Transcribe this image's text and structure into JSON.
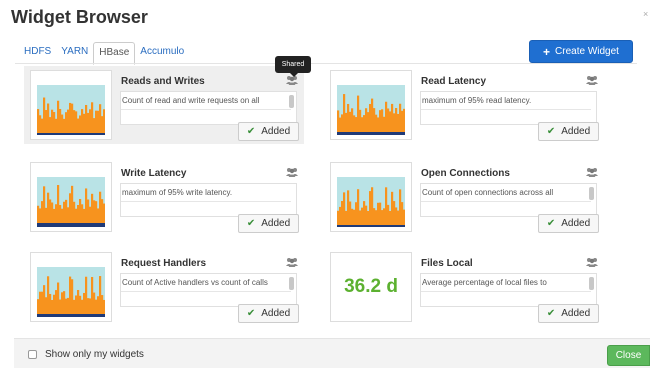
{
  "dialog": {
    "title": "Widget Browser"
  },
  "tabs": [
    {
      "label": "HDFS",
      "active": false
    },
    {
      "label": "YARN",
      "active": false
    },
    {
      "label": "HBase",
      "active": true
    },
    {
      "label": "Accumulo",
      "active": false
    }
  ],
  "create_button": {
    "label": "Create Widget",
    "icon": "plus-icon"
  },
  "tooltip": {
    "text": "Shared"
  },
  "widgets": [
    {
      "name": "Reads and Writes",
      "description": "Count of read and write requests on all",
      "thumbnail": "chart",
      "shared_icon": "users-icon",
      "status_label": "Added"
    },
    {
      "name": "Read Latency",
      "description": "maximum of 95% read latency.",
      "thumbnail": "chart",
      "shared_icon": "users-icon",
      "status_label": "Added"
    },
    {
      "name": "Write Latency",
      "description": "maximum of 95% write latency.",
      "thumbnail": "chart",
      "shared_icon": "users-icon",
      "status_label": "Added"
    },
    {
      "name": "Open Connections",
      "description": "Count of open connections across all",
      "thumbnail": "chart",
      "shared_icon": "users-icon",
      "status_label": "Added"
    },
    {
      "name": "Request Handlers",
      "description": "Count of Active handlers vs count of calls",
      "thumbnail": "chart",
      "shared_icon": "users-icon",
      "status_label": "Added"
    },
    {
      "name": "Files Local",
      "description": "Average percentage of local files to",
      "thumbnail": "number",
      "thumbnail_value": "36.2 d",
      "shared_icon": "users-icon",
      "status_label": "Added"
    }
  ],
  "footer": {
    "show_only_mine_label": "Show only my widgets",
    "show_only_mine_checked": false,
    "close_label": "Close"
  },
  "colors": {
    "primary": "#1f6fd1",
    "success": "#5cb85c",
    "number_green": "#5cb130",
    "chart_orange": "#f7931e",
    "chart_teal": "#b9e3e6",
    "chart_navy": "#1f3a78"
  }
}
